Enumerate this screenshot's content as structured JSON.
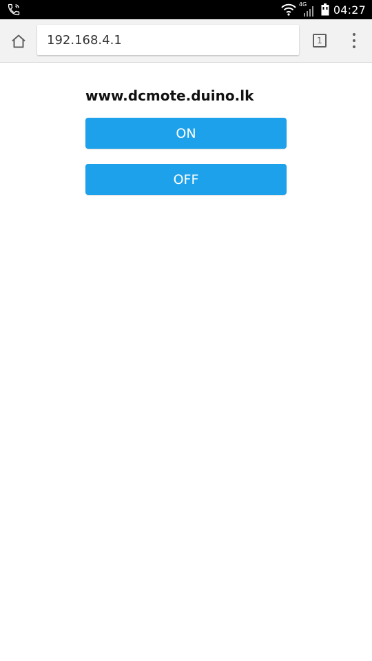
{
  "status_bar": {
    "network_type": "4G",
    "time": "04:27",
    "icons": [
      "phone-icon",
      "wifi-icon",
      "signal-icon",
      "battery-icon"
    ]
  },
  "browser": {
    "url": "192.168.4.1",
    "tab_count": "1",
    "icons": [
      "home-icon",
      "tabs-icon",
      "more-menu-icon"
    ]
  },
  "page": {
    "title": "www.dcmote.duino.lk",
    "on_label": "ON",
    "off_label": "OFF"
  },
  "colors": {
    "button": "#1da1ea",
    "status_bar": "#000000",
    "toolbar": "#f2f2f2"
  }
}
